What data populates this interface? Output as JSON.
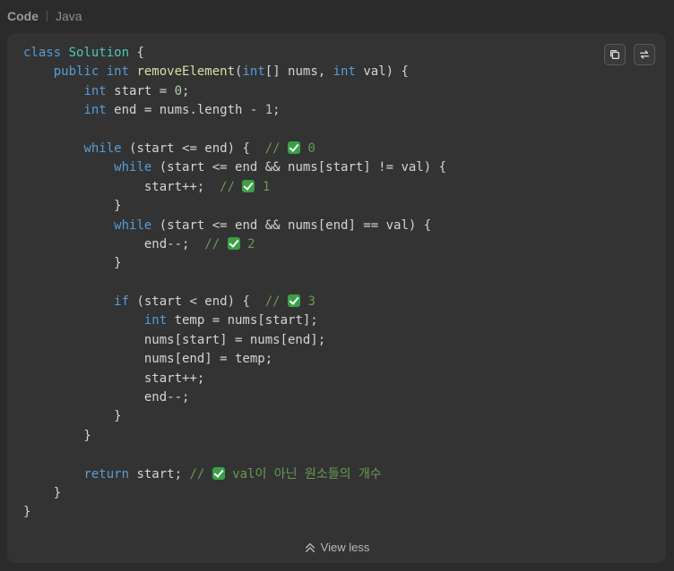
{
  "tabs": {
    "code_label": "Code",
    "lang_label": "Java"
  },
  "actions": {
    "copy_icon": "copy-icon",
    "wrap_icon": "swap-arrows-icon"
  },
  "code": {
    "lines": [
      [
        {
          "t": "class ",
          "c": "kw"
        },
        {
          "t": "Solution",
          "c": "cls"
        },
        {
          "t": " {"
        }
      ],
      [
        {
          "t": "    "
        },
        {
          "t": "public ",
          "c": "kw"
        },
        {
          "t": "int ",
          "c": "kw"
        },
        {
          "t": "removeElement",
          "c": "fn"
        },
        {
          "t": "("
        },
        {
          "t": "int",
          "c": "kw"
        },
        {
          "t": "[] nums, "
        },
        {
          "t": "int ",
          "c": "kw"
        },
        {
          "t": "val) {"
        }
      ],
      [
        {
          "t": "        "
        },
        {
          "t": "int ",
          "c": "kw"
        },
        {
          "t": "start = "
        },
        {
          "t": "0",
          "c": "num"
        },
        {
          "t": ";"
        }
      ],
      [
        {
          "t": "        "
        },
        {
          "t": "int ",
          "c": "kw"
        },
        {
          "t": "end = nums.length - "
        },
        {
          "t": "1",
          "c": "num"
        },
        {
          "t": ";"
        }
      ],
      [],
      [
        {
          "t": "        "
        },
        {
          "t": "while ",
          "c": "kw"
        },
        {
          "t": "(start <= end) {  "
        },
        {
          "t": "// ",
          "c": "cm"
        },
        {
          "check": true
        },
        {
          "t": " 0",
          "c": "cm"
        }
      ],
      [
        {
          "t": "            "
        },
        {
          "t": "while ",
          "c": "kw"
        },
        {
          "t": "(start <= end && nums[start] != val) {"
        }
      ],
      [
        {
          "t": "                start++;  "
        },
        {
          "t": "// ",
          "c": "cm"
        },
        {
          "check": true
        },
        {
          "t": " 1",
          "c": "cm"
        }
      ],
      [
        {
          "t": "            }"
        }
      ],
      [
        {
          "t": "            "
        },
        {
          "t": "while ",
          "c": "kw"
        },
        {
          "t": "(start <= end && nums[end] == val) {"
        }
      ],
      [
        {
          "t": "                end--;  "
        },
        {
          "t": "// ",
          "c": "cm"
        },
        {
          "check": true
        },
        {
          "t": " 2",
          "c": "cm"
        }
      ],
      [
        {
          "t": "            }"
        }
      ],
      [],
      [
        {
          "t": "            "
        },
        {
          "t": "if ",
          "c": "kw"
        },
        {
          "t": "(start < end) {  "
        },
        {
          "t": "// ",
          "c": "cm"
        },
        {
          "check": true
        },
        {
          "t": " 3",
          "c": "cm"
        }
      ],
      [
        {
          "t": "                "
        },
        {
          "t": "int ",
          "c": "kw"
        },
        {
          "t": "temp = nums[start];"
        }
      ],
      [
        {
          "t": "                nums[start] = nums[end];"
        }
      ],
      [
        {
          "t": "                nums[end] = temp;"
        }
      ],
      [
        {
          "t": "                start++;"
        }
      ],
      [
        {
          "t": "                end--;"
        }
      ],
      [
        {
          "t": "            }"
        }
      ],
      [
        {
          "t": "        }"
        }
      ],
      [],
      [
        {
          "t": "        "
        },
        {
          "t": "return ",
          "c": "kw"
        },
        {
          "t": "start; "
        },
        {
          "t": "// ",
          "c": "cm"
        },
        {
          "check": true
        },
        {
          "t": " val이 아닌 원소들의 개수",
          "c": "cm"
        }
      ],
      [
        {
          "t": "    }"
        }
      ],
      [
        {
          "t": "}"
        }
      ]
    ]
  },
  "footer": {
    "view_less_label": "View less"
  }
}
